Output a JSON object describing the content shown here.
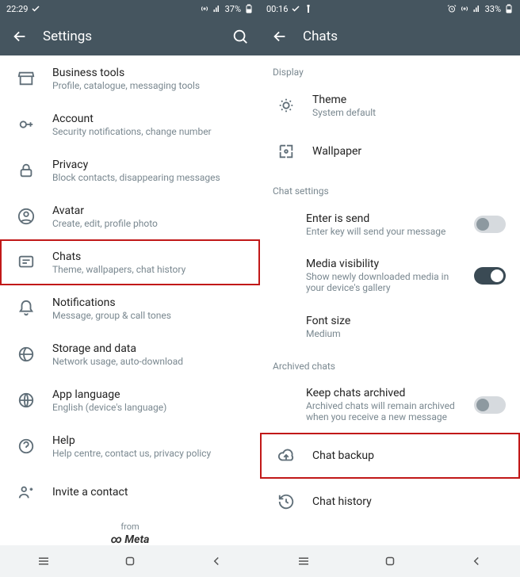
{
  "left": {
    "status": {
      "time": "22:29",
      "battery": "37%"
    },
    "appbar": {
      "title": "Settings"
    },
    "items": [
      {
        "icon": "storefront",
        "label": "Business tools",
        "sub": "Profile, catalogue, messaging tools"
      },
      {
        "icon": "key",
        "label": "Account",
        "sub": "Security notifications, change number"
      },
      {
        "icon": "lock",
        "label": "Privacy",
        "sub": "Block contacts, disappearing messages"
      },
      {
        "icon": "avatar",
        "label": "Avatar",
        "sub": "Create, edit, profile photo"
      },
      {
        "icon": "chat",
        "label": "Chats",
        "sub": "Theme, wallpapers, chat history",
        "hl": true
      },
      {
        "icon": "bell",
        "label": "Notifications",
        "sub": "Message, group & call tones"
      },
      {
        "icon": "data",
        "label": "Storage and data",
        "sub": "Network usage, auto-download"
      },
      {
        "icon": "globe",
        "label": "App language",
        "sub": "English (device's language)"
      },
      {
        "icon": "help",
        "label": "Help",
        "sub": "Help centre, contact us, privacy policy"
      },
      {
        "icon": "contacts",
        "label": "Invite a contact",
        "sub": ""
      }
    ],
    "footer": {
      "from": "from",
      "brand": "Meta"
    }
  },
  "right": {
    "status": {
      "time": "00:16",
      "battery": "33%"
    },
    "appbar": {
      "title": "Chats"
    },
    "sections": [
      {
        "header": "Display",
        "items": [
          {
            "icon": "theme",
            "label": "Theme",
            "sub": "System default"
          },
          {
            "icon": "wallpaper",
            "label": "Wallpaper",
            "sub": ""
          }
        ]
      },
      {
        "header": "Chat settings",
        "items": [
          {
            "label": "Enter is send",
            "sub": "Enter key will send your message",
            "toggle": "off"
          },
          {
            "label": "Media visibility",
            "sub": "Show newly downloaded media in your device's gallery",
            "toggle": "on"
          },
          {
            "label": "Font size",
            "sub": "Medium"
          }
        ]
      },
      {
        "header": "Archived chats",
        "items": [
          {
            "label": "Keep chats archived",
            "sub": "Archived chats will remain archived when you receive a new message",
            "toggle": "off"
          }
        ]
      },
      {
        "header": "",
        "items": [
          {
            "icon": "cloud",
            "label": "Chat backup",
            "sub": "",
            "hl": true
          },
          {
            "icon": "history",
            "label": "Chat history",
            "sub": ""
          }
        ]
      }
    ]
  }
}
